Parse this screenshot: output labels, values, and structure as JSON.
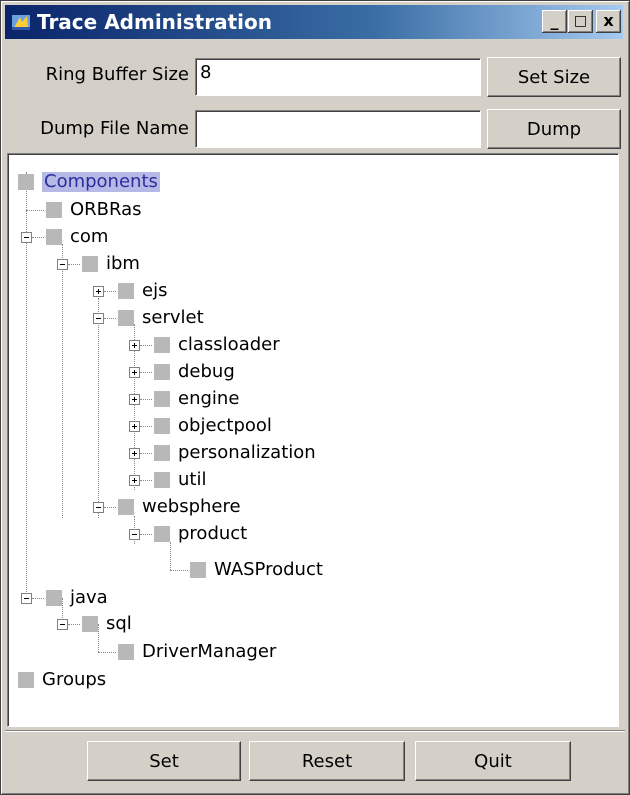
{
  "window": {
    "title": "Trace Administration",
    "minimize": "_",
    "maximize": "□",
    "close": "x"
  },
  "form": {
    "ring_label": "Ring Buffer Size",
    "ring_value": "8",
    "set_size_label": "Set Size",
    "dump_label": "Dump File Name",
    "dump_value": "",
    "dump_button_label": "Dump"
  },
  "tree": {
    "components": "Components",
    "orbras": "ORBRas",
    "com": "com",
    "ibm": "ibm",
    "ejs": "ejs",
    "servlet": "servlet",
    "classloader": "classloader",
    "debug": "debug",
    "engine": "engine",
    "objectpool": "objectpool",
    "personalization": "personalization",
    "util": "util",
    "websphere": "websphere",
    "product": "product",
    "wasproduct": "WASProduct",
    "java": "java",
    "sql": "sql",
    "drivermanager": "DriverManager",
    "groups": "Groups"
  },
  "buttons": {
    "set": "Set",
    "reset": "Reset",
    "quit": "Quit"
  }
}
